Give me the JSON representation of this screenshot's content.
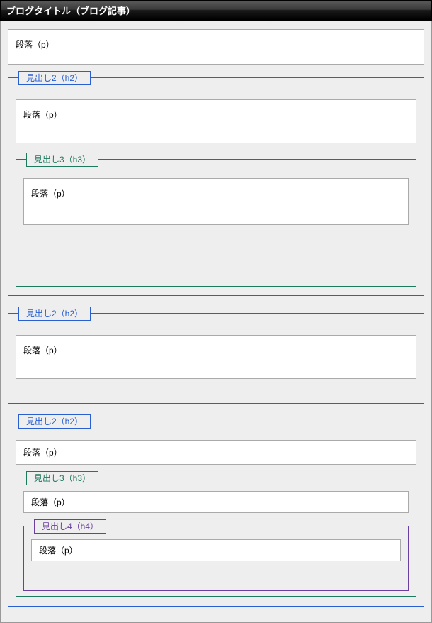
{
  "title": "ブログタイトル（ブログ記事）",
  "labels": {
    "paragraph": "段落（p）",
    "h2": "見出し2（h2）",
    "h3": "見出し3（h3）",
    "h4": "見出し4（h4）"
  },
  "colors": {
    "h2": "#2a5fd0",
    "h3": "#1d7a5f",
    "h4": "#6b3fa0",
    "pageBg": "#eeeeee",
    "boxBorder": "#aaaaaa"
  },
  "structure": [
    {
      "type": "p"
    },
    {
      "type": "h2",
      "children": [
        {
          "type": "p"
        },
        {
          "type": "h3",
          "children": [
            {
              "type": "p"
            }
          ]
        }
      ]
    },
    {
      "type": "h2",
      "children": [
        {
          "type": "p"
        }
      ]
    },
    {
      "type": "h2",
      "children": [
        {
          "type": "p"
        },
        {
          "type": "h3",
          "children": [
            {
              "type": "p"
            },
            {
              "type": "h4",
              "children": [
                {
                  "type": "p"
                }
              ]
            }
          ]
        }
      ]
    }
  ]
}
